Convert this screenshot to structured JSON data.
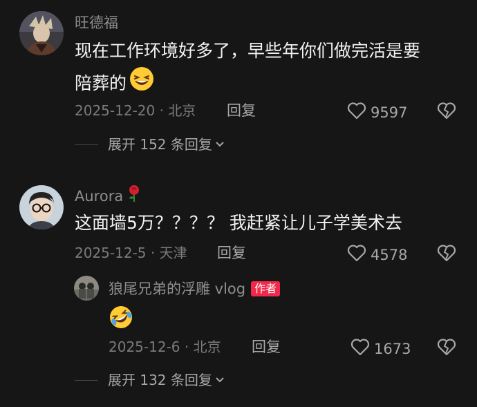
{
  "comments": [
    {
      "username": "旺德福",
      "text_line1": "现在工作环境好多了，早些年你们做完活是要",
      "text_line2": "陪葬的",
      "emoji": "grinning-squint-face",
      "date": "2025-12-20",
      "location": "北京",
      "reply_label": "回复",
      "likes": "9597",
      "expand_label": "展开 152 条回复"
    },
    {
      "username": "Aurora",
      "username_emoji": "rose",
      "text": "这面墙5万？？？？ 我赶紧让儿子学美术去",
      "date": "2025-12-5",
      "location": "天津",
      "reply_label": "回复",
      "likes": "4578",
      "reply": {
        "username": "狼尾兄弟的浮雕 vlog",
        "badge": "作者",
        "emoji": "rolling-on-floor-laughing",
        "date": "2025-12-6",
        "location": "北京",
        "reply_label": "回复",
        "likes": "1673"
      },
      "expand_label": "展开 132 条回复"
    }
  ],
  "colors": {
    "background": "#161616",
    "text": "#f2f2f2",
    "muted": "#7b7b7b",
    "badge": "#f0284a"
  }
}
